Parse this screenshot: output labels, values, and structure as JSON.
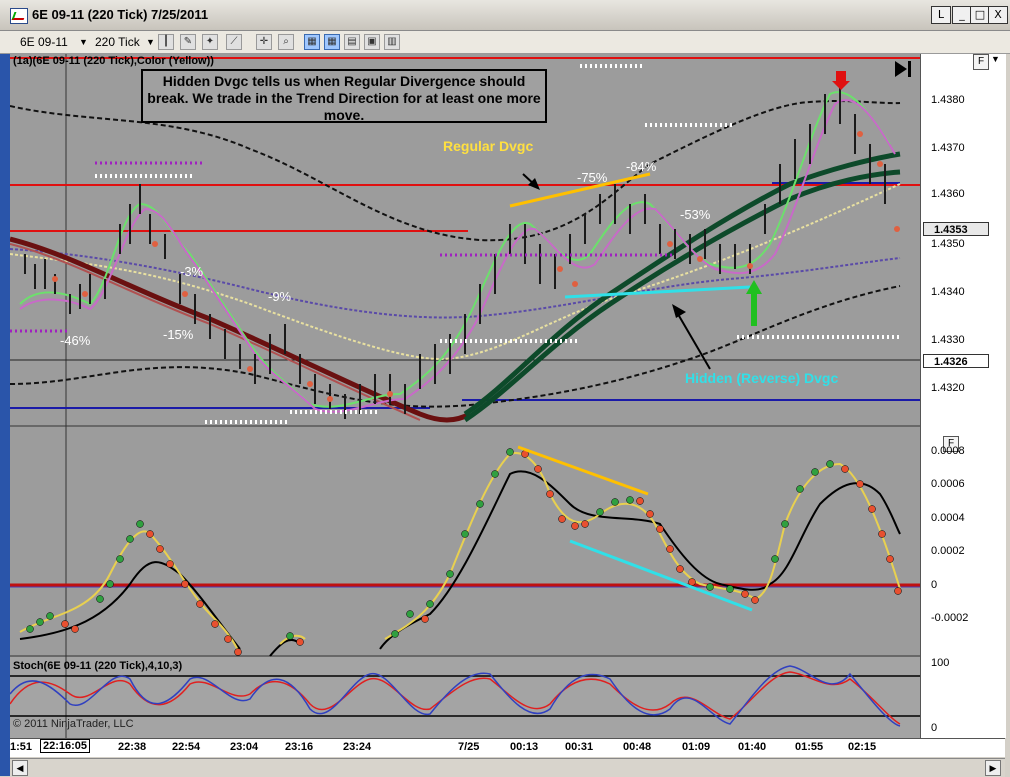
{
  "window": {
    "title": "6E 09-11 (220 Tick)  7/25/2011",
    "controls": [
      "L",
      "_",
      "□",
      "X"
    ]
  },
  "toolbar": {
    "instrument": "6E 09-11",
    "interval": "220 Tick"
  },
  "panel1": {
    "label": "(1a)(6E 09-11 (220 Tick),Color (Yellow))",
    "fbutton": "F",
    "annotation": "Hidden Dvgc tells us when Regular Divergence should break. We trade in the Trend Direction for at least one more move.",
    "regular_dvgc": "Regular Dvgc",
    "hidden_dvgc": "Hidden (Reverse) Dvgc",
    "pct_labels": [
      "-46%",
      "-15%",
      "-3%",
      "-9%",
      "-75%",
      "-84%",
      "-53%"
    ],
    "price_axis": [
      "1.4380",
      "1.4370",
      "1.4360",
      "1.4350",
      "1.4340",
      "1.4330",
      "1.4320"
    ],
    "price_tag_current": "1.4353",
    "price_tag_line": "1.4326"
  },
  "panel2": {
    "fbutton": "F",
    "axis": [
      "0.0008",
      "0.0006",
      "0.0004",
      "0.0002",
      "0",
      "-0.0002"
    ]
  },
  "panel3": {
    "label": "Stoch(6E 09-11 (220 Tick),4,10,3)",
    "copyright": "© 2011 NinjaTrader, LLC",
    "axis": [
      "100",
      "0"
    ]
  },
  "xaxis": {
    "labels": [
      "1:51",
      "22:16:05",
      "22:38",
      "22:54",
      "23:04",
      "23:16",
      "23:24",
      "7/25",
      "00:13",
      "00:31",
      "00:48",
      "01:09",
      "01:40",
      "01:55",
      "02:15"
    ]
  },
  "colors": {
    "panel_bg": "#9c9c9c",
    "red_line": "#e01010",
    "blue_line": "#1a1aa8",
    "yellow": "#ffc000",
    "cyan": "#30e0e8",
    "dark_green": "#0d4a2a"
  }
}
